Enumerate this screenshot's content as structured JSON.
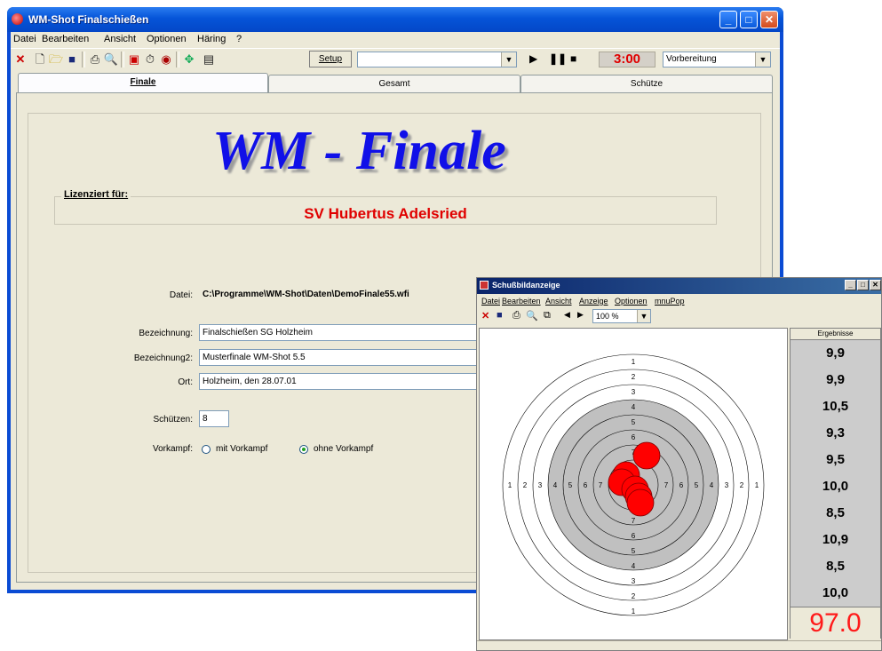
{
  "main_window": {
    "title": "WM-Shot Finalschießen",
    "menu": [
      "Datei",
      "Bearbeiten",
      "Ansicht",
      "Optionen",
      "Häring",
      "?"
    ],
    "toolbar": {
      "setup_label": "Setup",
      "timer": "3:00",
      "phase_value": "Vorbereitung"
    },
    "tabs": [
      "Finale",
      "Gesamt",
      "Schütze"
    ],
    "headline": "WM - Finale",
    "licensed_label": "Lizenziert für:",
    "licensee": "SV Hubertus Adelsried",
    "datei_label": "Datei:",
    "datei_path": "C:\\Programme\\WM-Shot\\Daten\\DemoFinale55.wfi",
    "bezeichnung_label": "Bezeichnung:",
    "bezeichnung_value": "Finalschießen SG Holzheim",
    "bezeichnung2_label": "Bezeichnung2:",
    "bezeichnung2_value": "Musterfinale WM-Shot 5.5",
    "ort_label": "Ort:",
    "ort_value": "Holzheim, den 28.07.01",
    "schuetzen_label": "Schützen:",
    "schuetzen_value": "8",
    "vorkampf_label": "Vorkampf:",
    "radio_mit": "mit Vorkampf",
    "radio_ohne": "ohne Vorkampf",
    "radio_selected": "ohne Vorkampf"
  },
  "target_window": {
    "title": "Schußbildanzeige",
    "menu": [
      "Datei",
      "Bearbeiten",
      "Ansicht",
      "Anzeige",
      "Optionen",
      "mnuPop"
    ],
    "zoom": "100 %",
    "ring_labels_vertical": [
      "1",
      "2",
      "3",
      "4",
      "5",
      "6",
      "7",
      "7",
      "6",
      "5",
      "4",
      "3",
      "2",
      "1"
    ],
    "ring_labels_horizontal": [
      "1",
      "2",
      "3",
      "4",
      "5",
      "6",
      "7",
      "8",
      "7",
      "6",
      "5",
      "4",
      "3",
      "2",
      "1"
    ],
    "results_header": "Ergebnisse",
    "results": [
      "9,9",
      "9,9",
      "10,5",
      "9,3",
      "9,5",
      "10,0",
      "8,5",
      "10,9",
      "8,5",
      "10,0"
    ],
    "total": "97.0",
    "shot_color": "#ff0000"
  },
  "colors": {
    "headline": "#1010e8",
    "licensee": "#e00000",
    "timer": "#e00000",
    "total": "#ff1a1a",
    "xp_blue": "#0554d8"
  }
}
